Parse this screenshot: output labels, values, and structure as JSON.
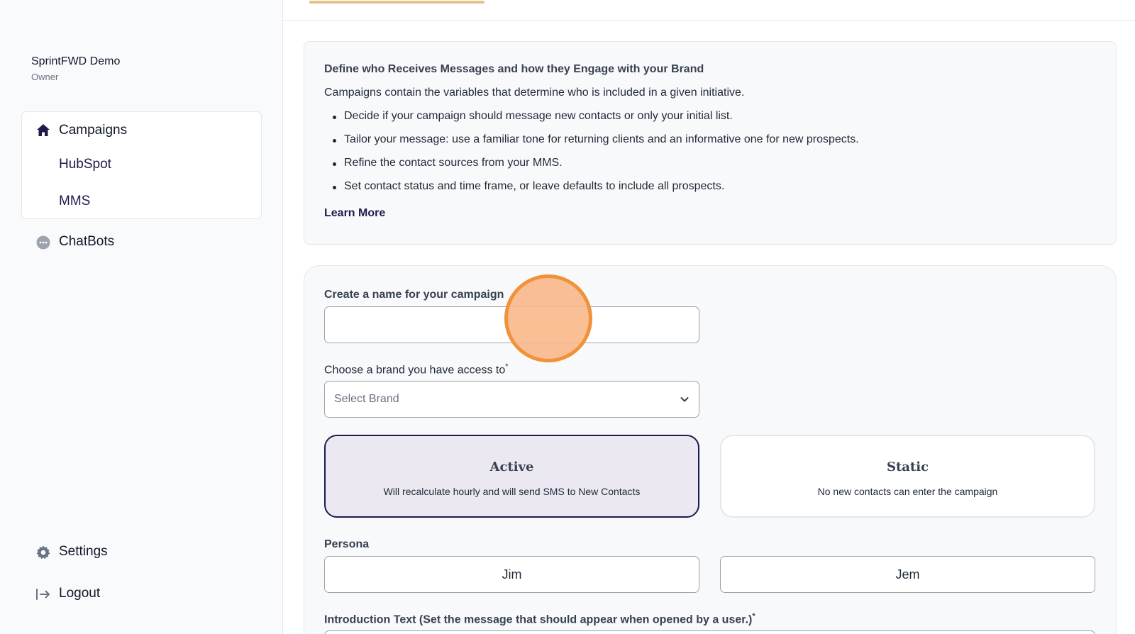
{
  "sidebar": {
    "org_name": "SprintFWD Demo",
    "org_role": "Owner",
    "items": [
      {
        "label": "Campaigns",
        "icon": "home-icon"
      },
      {
        "label": "HubSpot"
      },
      {
        "label": "MMS"
      },
      {
        "label": "ChatBots",
        "icon": "chat-bubble-icon"
      },
      {
        "label": "Settings",
        "icon": "gear-icon"
      },
      {
        "label": "Logout",
        "icon": "logout-icon"
      }
    ]
  },
  "info": {
    "title": "Define who Receives Messages and how they Engage with your Brand",
    "description": "Campaigns contain the variables that determine who is included in a given initiative.",
    "bullets": [
      "Decide if your campaign should message new contacts or only your initial list.",
      "Tailor your message: use a familiar tone for returning clients and an informative one for new prospects.",
      "Refine the contact sources from your MMS.",
      "Set contact status and time frame, or leave defaults to include all prospects."
    ],
    "learn_more": "Learn More"
  },
  "form": {
    "name_label": "Create a name for your campaign",
    "name_value": "",
    "brand_label": "Choose a brand you have access to",
    "required_mark": "*",
    "brand_placeholder": "Select Brand",
    "modes": [
      {
        "title": "Active",
        "desc": "Will recalculate hourly and will send SMS to New Contacts",
        "selected": true
      },
      {
        "title": "Static",
        "desc": "No new contacts can enter the campaign",
        "selected": false
      }
    ],
    "persona_label": "Persona",
    "personas": [
      "Jim",
      "Jem"
    ],
    "intro_label": "Introduction Text (Set the message that should appear when opened by a user.)"
  },
  "colors": {
    "brand": "#1e1b4b",
    "accent": "#e2c28a",
    "click_marker": "#f0923a"
  }
}
